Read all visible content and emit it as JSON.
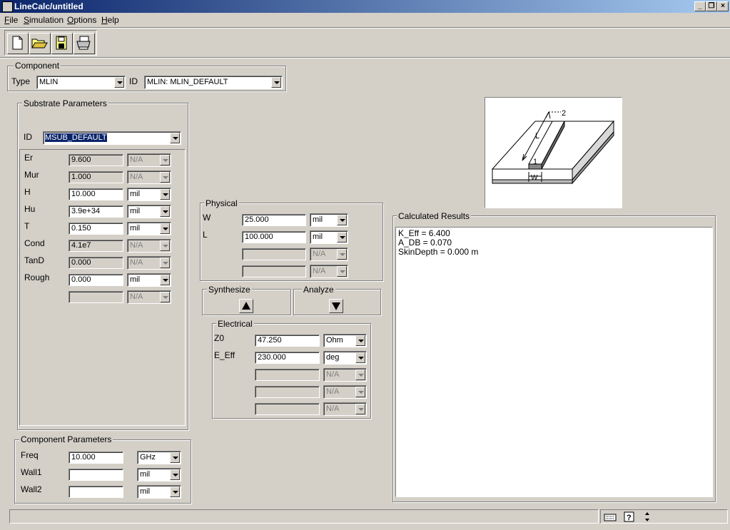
{
  "window": {
    "title": "LineCalc/untitled"
  },
  "menu": [
    "File",
    "Simulation",
    "Options",
    "Help"
  ],
  "menu_underline": [
    "F",
    "S",
    "O",
    "H"
  ],
  "toolbar": {
    "icons": [
      "new-file-icon",
      "open-folder-icon",
      "save-disk-icon",
      "print-icon"
    ]
  },
  "component": {
    "label": "Component",
    "type_label": "Type",
    "type_value": "MLIN",
    "id_label": "ID",
    "id_value": "MLIN: MLIN_DEFAULT"
  },
  "substrate": {
    "label": "Substrate Parameters",
    "id_label": "ID",
    "id_value": "MSUB_DEFAULT",
    "params": [
      {
        "name": "Er",
        "value": "9.600",
        "unit": "N/A",
        "enabled": false
      },
      {
        "name": "Mur",
        "value": "1.000",
        "unit": "N/A",
        "enabled": false
      },
      {
        "name": "H",
        "value": "10.000",
        "unit": "mil",
        "enabled": true
      },
      {
        "name": "Hu",
        "value": "3.9e+34",
        "unit": "mil",
        "enabled": true
      },
      {
        "name": "T",
        "value": "0.150",
        "unit": "mil",
        "enabled": true
      },
      {
        "name": "Cond",
        "value": "4.1e7",
        "unit": "N/A",
        "enabled": false
      },
      {
        "name": "TanD",
        "value": "0.000",
        "unit": "N/A",
        "enabled": false
      },
      {
        "name": "Rough",
        "value": "0.000",
        "unit": "mil",
        "enabled": true
      },
      {
        "name": "",
        "value": "",
        "unit": "N/A",
        "enabled": false
      }
    ]
  },
  "component_params": {
    "label": "Component Parameters",
    "params": [
      {
        "name": "Freq",
        "value": "10.000",
        "unit": "GHz"
      },
      {
        "name": "Wall1",
        "value": "",
        "unit": "mil"
      },
      {
        "name": "Wall2",
        "value": "",
        "unit": "mil"
      }
    ]
  },
  "physical": {
    "label": "Physical",
    "params": [
      {
        "name": "W",
        "value": "25.000",
        "unit": "mil",
        "enabled": true
      },
      {
        "name": "L",
        "value": "100.000",
        "unit": "mil",
        "enabled": true
      },
      {
        "name": "",
        "value": "",
        "unit": "N/A",
        "enabled": false
      },
      {
        "name": "",
        "value": "",
        "unit": "N/A",
        "enabled": false
      }
    ]
  },
  "synthesize": {
    "label": "Synthesize"
  },
  "analyze": {
    "label": "Analyze"
  },
  "electrical": {
    "label": "Electrical",
    "params": [
      {
        "name": "Z0",
        "value": "47.250",
        "unit": "Ohm",
        "enabled": true
      },
      {
        "name": "E_Eff",
        "value": "230.000",
        "unit": "deg",
        "enabled": true
      },
      {
        "name": "",
        "value": "",
        "unit": "N/A",
        "enabled": false
      },
      {
        "name": "",
        "value": "",
        "unit": "N/A",
        "enabled": false
      },
      {
        "name": "",
        "value": "",
        "unit": "N/A",
        "enabled": false
      }
    ]
  },
  "diagram": {
    "labels": [
      "L",
      "2",
      "1",
      "W"
    ]
  },
  "results": {
    "label": "Calculated Results",
    "lines": [
      "K_Eff = 6.400",
      "A_DB = 0.070",
      "SkinDepth = 0.000 m"
    ]
  }
}
